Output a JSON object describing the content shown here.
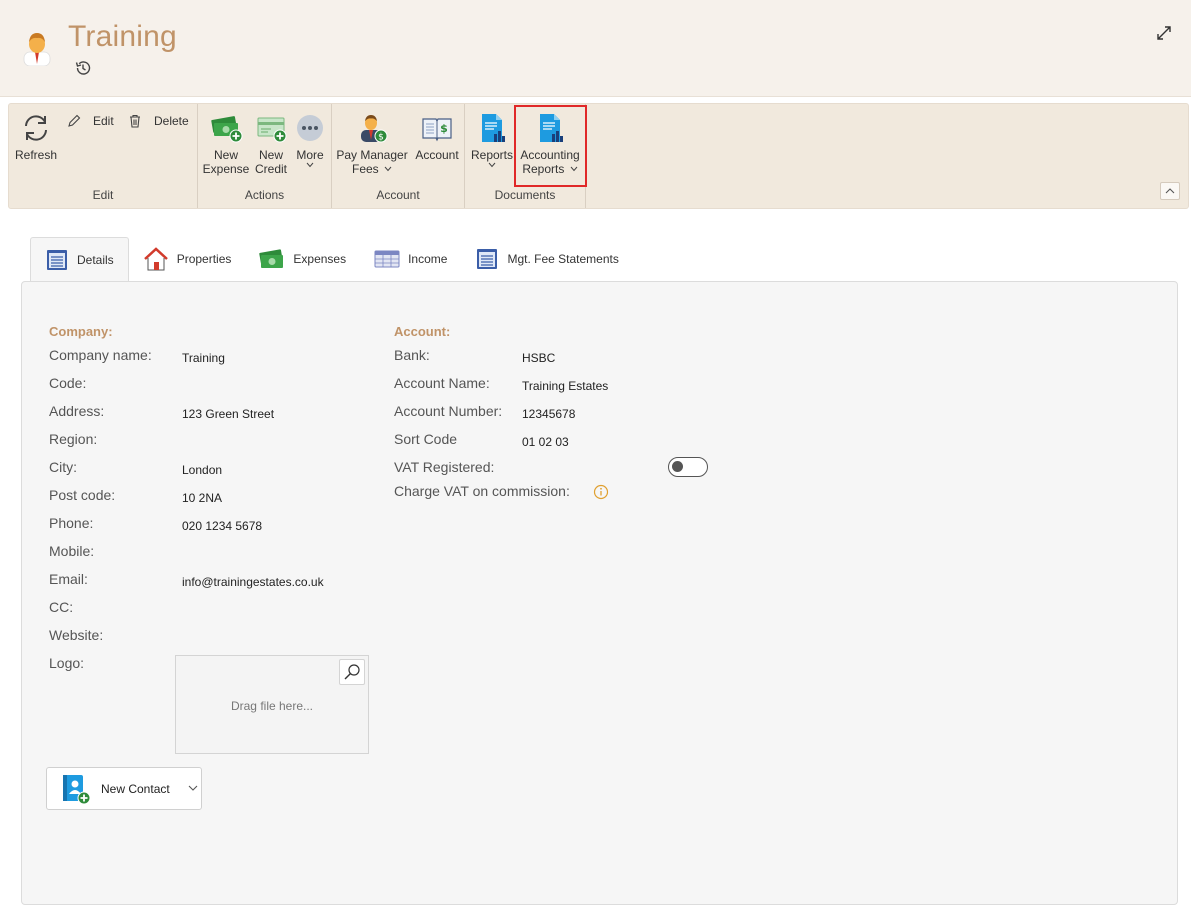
{
  "header": {
    "title": "Training",
    "avatar_icon": "manager-avatar-icon",
    "history_icon": "history-icon",
    "expand_icon": "expand-icon"
  },
  "ribbon": {
    "groups": [
      {
        "label": "Edit"
      },
      {
        "label": "Actions"
      },
      {
        "label": "Account"
      },
      {
        "label": "Documents"
      }
    ],
    "buttons": {
      "refresh": "Refresh",
      "edit": "Edit",
      "delete": "Delete",
      "new_expense_1": "New",
      "new_expense_2": "Expense",
      "new_credit_1": "New",
      "new_credit_2": "Credit",
      "more": "More",
      "pay_manager_1": "Pay Manager",
      "pay_manager_2": "Fees",
      "account": "Account",
      "reports": "Reports",
      "accounting_reports_1": "Accounting",
      "accounting_reports_2": "Reports"
    }
  },
  "tabs": [
    {
      "label": "Details",
      "active": true
    },
    {
      "label": "Properties"
    },
    {
      "label": "Expenses"
    },
    {
      "label": "Income"
    },
    {
      "label": "Mgt. Fee Statements"
    }
  ],
  "company": {
    "section_title": "Company:",
    "fields": [
      {
        "label": "Company name:",
        "value": "Training"
      },
      {
        "label": "Code:",
        "value": ""
      },
      {
        "label": "Address:",
        "value": "123 Green Street"
      },
      {
        "label": "Region:",
        "value": ""
      },
      {
        "label": "City:",
        "value": "London"
      },
      {
        "label": "Post code:",
        "value": "10 2NA"
      },
      {
        "label": "Phone:",
        "value": "020 1234 5678"
      },
      {
        "label": "Mobile:",
        "value": ""
      },
      {
        "label": "Email:",
        "value": "info@trainingestates.co.uk"
      },
      {
        "label": "CC:",
        "value": ""
      },
      {
        "label": "Website:",
        "value": ""
      },
      {
        "label": "Logo:",
        "value": ""
      }
    ],
    "dropzone_text": "Drag file here..."
  },
  "account": {
    "section_title": "Account:",
    "fields": [
      {
        "label": "Bank:",
        "value": "HSBC"
      },
      {
        "label": "Account Name:",
        "value": "Training Estates"
      },
      {
        "label": "Account Number:",
        "value": "12345678"
      },
      {
        "label": "Sort Code",
        "value": "01 02 03"
      },
      {
        "label": "VAT Registered:",
        "value": ""
      },
      {
        "label": "Charge VAT on commission:",
        "value": ""
      }
    ],
    "vat_registered": false
  },
  "contact_button": {
    "label": "New Contact"
  },
  "colors": {
    "accent": "#c09368",
    "highlight": "#e02828",
    "ribbon_bg": "#f1e9dd",
    "header_bg": "#f6f1eb"
  }
}
